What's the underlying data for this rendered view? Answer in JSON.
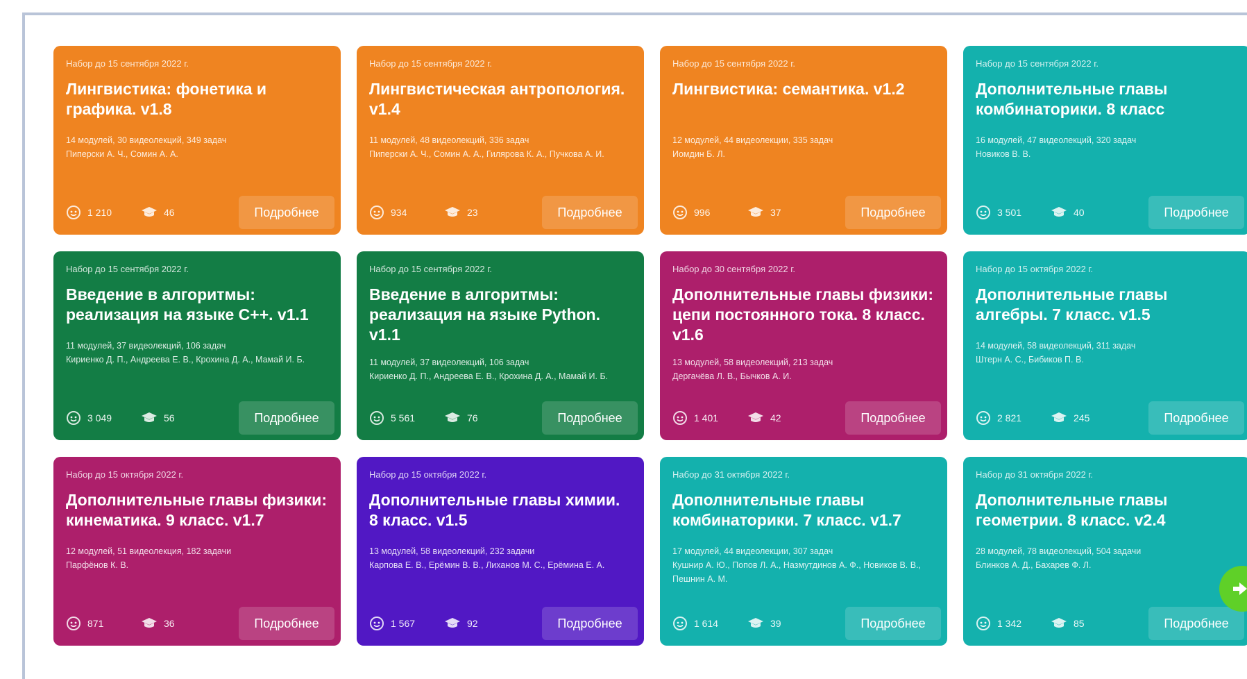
{
  "courses": [
    {
      "deadline": "Набор до 15 сентября 2022 г.",
      "title": "Лингвистика: фонетика и графика. v1.8",
      "stats": "14 модулей, 30 видеолекций, 349 задач",
      "authors": "Пиперски А. Ч., Сомин А. А.",
      "learners": "1 210",
      "graduates": "46",
      "more": "Подробнее",
      "color": "#ef8421"
    },
    {
      "deadline": "Набор до 15 сентября 2022 г.",
      "title": "Лингвистическая антропология. v1.4",
      "stats": "11 модулей, 48 видеолекций, 336 задач",
      "authors": "Пиперски А. Ч., Сомин А. А., Гилярова К. А., Пучкова А. И.",
      "learners": "934",
      "graduates": "23",
      "more": "Подробнее",
      "color": "#ef8421"
    },
    {
      "deadline": "Набор до 15 сентября 2022 г.",
      "title": "Лингвистика: семантика. v1.2",
      "stats": "12 модулей, 44 видеолекции, 335 задач",
      "authors": "Иомдин Б. Л.",
      "learners": "996",
      "graduates": "37",
      "more": "Подробнее",
      "color": "#ef8421"
    },
    {
      "deadline": "Набор до 15 сентября 2022 г.",
      "title": "Дополнительные главы комбинаторики. 8 класс",
      "stats": "16 модулей, 47 видеолекций, 320 задач",
      "authors": "Новиков В. В.",
      "learners": "3 501",
      "graduates": "40",
      "more": "Подробнее",
      "color": "#14b1ad"
    },
    {
      "deadline": "Набор до 15 сентября 2022 г.",
      "title": "Введение в алгоритмы: реализация на языке C++. v1.1",
      "stats": "11 модулей, 37 видеолекций, 106 задач",
      "authors": "Кириенко Д. П., Андреева Е. В., Крохина Д. А., Мамай И. Б.",
      "learners": "3 049",
      "graduates": "56",
      "more": "Подробнее",
      "color": "#137d45"
    },
    {
      "deadline": "Набор до 15 сентября 2022 г.",
      "title": "Введение в алгоритмы: реализация на языке Python. v1.1",
      "stats": "11 модулей, 37 видеолекций, 106 задач",
      "authors": "Кириенко Д. П., Андреева Е. В., Крохина Д. А., Мамай И. Б.",
      "learners": "5 561",
      "graduates": "76",
      "more": "Подробнее",
      "color": "#137d45"
    },
    {
      "deadline": "Набор до 30 сентября 2022 г.",
      "title": "Дополнительные главы физики: цепи постоянного тока. 8 класс. v1.6",
      "stats": "13 модулей, 58 видеолекций, 213 задач",
      "authors": "Деpгачёва Л. В., Бычков А. И.",
      "learners": "1 401",
      "graduates": "42",
      "more": "Подробнее",
      "color": "#ad1f6b"
    },
    {
      "deadline": "Набор до 15 октября 2022 г.",
      "title": "Дополнительные главы алгебры. 7 класс. v1.5",
      "stats": "14 модулей, 58 видеолекций, 311 задач",
      "authors": "Штерн А. С., Бибиков П. В.",
      "learners": "2 821",
      "graduates": "245",
      "more": "Подробнее",
      "color": "#14b1ad"
    },
    {
      "deadline": "Набор до 15 октября 2022 г.",
      "title": "Дополнительные главы физики: кинематика. 9 класс. v1.7",
      "stats": "12 модулей, 51 видеолекция, 182 задачи",
      "authors": "Парфёнов К. В.",
      "learners": "871",
      "graduates": "36",
      "more": "Подробнее",
      "color": "#ad1f6b"
    },
    {
      "deadline": "Набор до 15 октября 2022 г.",
      "title": "Дополнительные главы химии. 8 класс. v1.5",
      "stats": "13 модулей, 58 видеолекций, 232 задачи",
      "authors": "Карпова Е. В., Ерёмин В. В., Лиханов М. С., Ерёмина Е. А.",
      "learners": "1 567",
      "graduates": "92",
      "more": "Подробнее",
      "color": "#5118c4"
    },
    {
      "deadline": "Набор до 31 октября 2022 г.",
      "title": "Дополнительные главы комбинаторики. 7 класс. v1.7",
      "stats": "17 модулей, 44 видеолекции, 307 задач",
      "authors": "Кушнир А. Ю., Попов Л. А., Назмутдинов А. Ф., Новиков В. В., Пешнин А. М.",
      "learners": "1 614",
      "graduates": "39",
      "more": "Подробнее",
      "color": "#14b1ad"
    },
    {
      "deadline": "Набор до 31 октября 2022 г.",
      "title": "Дополнительные главы геометрии. 8 класс. v2.4",
      "stats": "28 модулей, 78 видеолекций, 504 задачи",
      "authors": "Блинков А. Д., Бахарев Ф. Л.",
      "learners": "1 342",
      "graduates": "85",
      "more": "Подробнее",
      "color": "#14b1ad"
    }
  ],
  "icons": {
    "learners": "smiley-icon",
    "graduates": "graduation-cap-icon",
    "fab": "arrow-right-icon"
  },
  "fab_color": "#5fd028"
}
